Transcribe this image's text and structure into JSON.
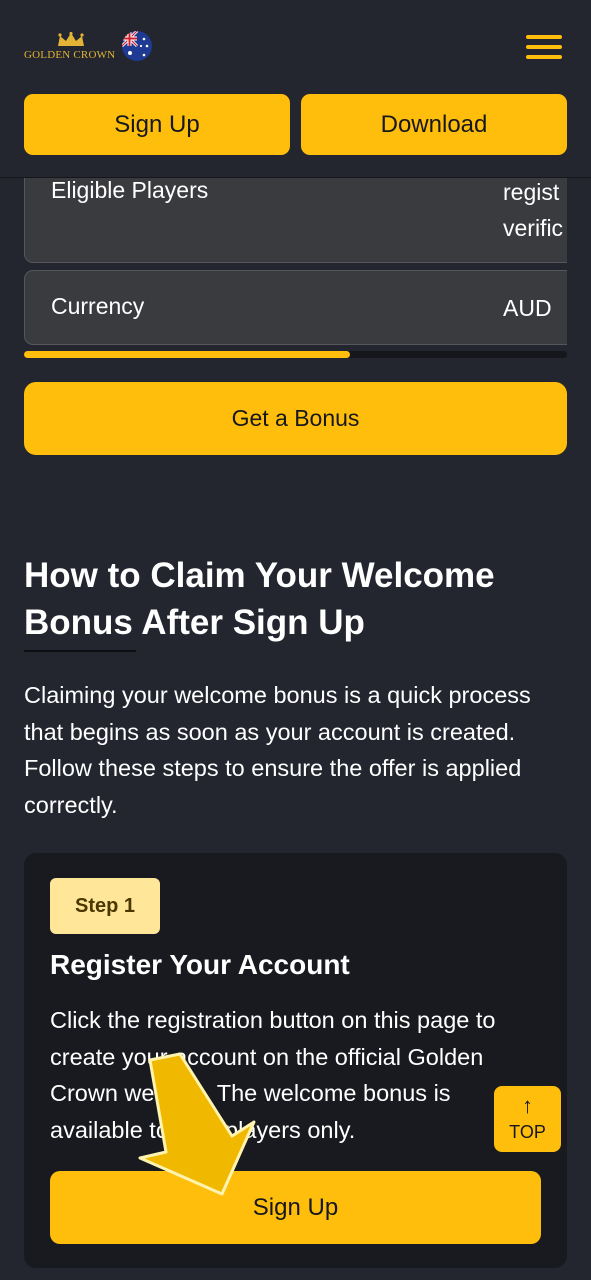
{
  "header": {
    "logo_text": "GOLDEN CROWN",
    "flag_icon": "australia-flag-icon",
    "menu_icon": "hamburger-menu-icon",
    "signup_label": "Sign Up",
    "download_label": "Download"
  },
  "table": {
    "rows": [
      {
        "key": "Eligible Players",
        "value_lines": [
          "regist",
          "verific"
        ]
      },
      {
        "key": "Currency",
        "value": "AUD"
      }
    ],
    "scroll_progress": 0.6
  },
  "bonus_button_label": "Get a Bonus",
  "section": {
    "title": "How to Claim Your Welcome Bonus After Sign Up",
    "intro": "Claiming your welcome bonus is a quick process that begins as soon as your account is created. Follow these steps to ensure the offer is applied correctly."
  },
  "step": {
    "badge": "Step 1",
    "title": "Register Your Account",
    "text": "Click the registration button on this page to create your account on the official Golden Crown website. The welcome bonus is available to new players only.",
    "button_label": "Sign Up"
  },
  "top_button": {
    "icon": "arrow-up-icon",
    "label": "TOP"
  },
  "colors": {
    "accent": "#ffbe0b",
    "background": "#23262f",
    "card": "#191a1f",
    "badge": "#ffe699"
  }
}
